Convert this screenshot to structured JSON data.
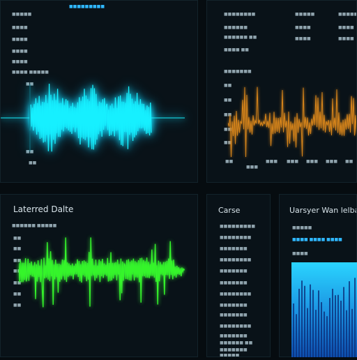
{
  "panels": {
    "top_left": {
      "labels": [
        "■■■■■",
        "■■■■",
        "■■■■",
        "■■■■",
        "■■■■",
        "■■■■ ■■■■■"
      ],
      "header_link": "■■■■■■■■■",
      "axis_top": "■■",
      "axis_bottom": "■■",
      "axis_bottom2": "■■"
    },
    "top_right": {
      "col1": [
        "■■■■■■■■",
        "■■■■■■",
        "■■■■■■ ■■",
        "■■■■ ■■",
        "■■■■■■■"
      ],
      "col2": [
        "■■■■■",
        "■■■■",
        "■■■■"
      ],
      "col3": [
        "■■■■■",
        "■■■■",
        "■■■■"
      ],
      "y_ticks": [
        "■■",
        "■■",
        "■■",
        "■■",
        "■■",
        "■■"
      ],
      "x_ticks": [
        "■■",
        "■■■",
        "■■■",
        "■■■",
        "■■■",
        "■■■",
        "■■"
      ]
    },
    "bottom_left": {
      "title": "Laterred Dalte",
      "subtitle": "■■■■■■ ■■■■■",
      "y_ticks": [
        "■■",
        "■■",
        "■■",
        "■■",
        "■■",
        "■■",
        "■■"
      ]
    },
    "bottom_mid": {
      "title": "Carse",
      "items": [
        "■■■■■■■■■",
        "■■■■■■■■",
        "■■■■■■■",
        "■■■■■■■■",
        "■■■■■■■",
        "■■■■■■■",
        "■■■■■■■■",
        "■■■■■■■",
        "■■■■■■■",
        "■■■■■■■■",
        "■■■■■■■",
        "■■■■■■ ■■",
        "■■■■■■■",
        "■■■■■"
      ]
    },
    "bottom_right": {
      "title": "Uarsyer Wan lelbant",
      "line1": "■■■■■",
      "line2": "■■■■ ■■■■ ■■■■",
      "line3": "■■■■"
    }
  },
  "colors": {
    "cyan_wave": "#16f0ff",
    "orange_wave": "#d7851b",
    "green_wave": "#35f52a",
    "blue_bars": "#2ad4ff"
  }
}
